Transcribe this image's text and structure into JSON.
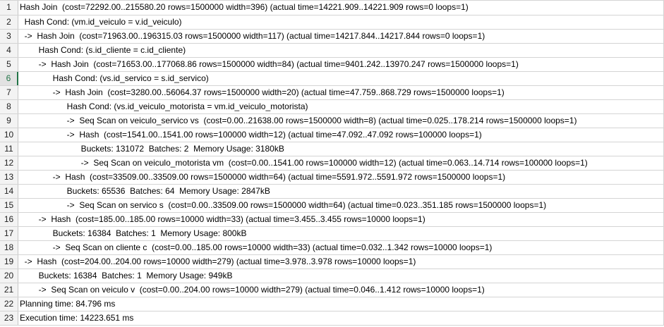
{
  "rows": [
    {
      "n": "1",
      "text": "Hash Join  (cost=72292.00..215580.20 rows=1500000 width=396) (actual time=14221.909..14221.909 rows=0 loops=1)"
    },
    {
      "n": "2",
      "text": "  Hash Cond: (vm.id_veiculo = v.id_veiculo)"
    },
    {
      "n": "3",
      "text": "  ->  Hash Join  (cost=71963.00..196315.03 rows=1500000 width=117) (actual time=14217.844..14217.844 rows=0 loops=1)"
    },
    {
      "n": "4",
      "text": "        Hash Cond: (s.id_cliente = c.id_cliente)"
    },
    {
      "n": "5",
      "text": "        ->  Hash Join  (cost=71653.00..177068.86 rows=1500000 width=84) (actual time=9401.242..13970.247 rows=1500000 loops=1)"
    },
    {
      "n": "6",
      "text": "              Hash Cond: (vs.id_servico = s.id_servico)"
    },
    {
      "n": "7",
      "text": "              ->  Hash Join  (cost=3280.00..56064.37 rows=1500000 width=20) (actual time=47.759..868.729 rows=1500000 loops=1)"
    },
    {
      "n": "8",
      "text": "                    Hash Cond: (vs.id_veiculo_motorista = vm.id_veiculo_motorista)"
    },
    {
      "n": "9",
      "text": "                    ->  Seq Scan on veiculo_servico vs  (cost=0.00..21638.00 rows=1500000 width=8) (actual time=0.025..178.214 rows=1500000 loops=1)"
    },
    {
      "n": "10",
      "text": "                    ->  Hash  (cost=1541.00..1541.00 rows=100000 width=12) (actual time=47.092..47.092 rows=100000 loops=1)"
    },
    {
      "n": "11",
      "text": "                          Buckets: 131072  Batches: 2  Memory Usage: 3180kB"
    },
    {
      "n": "12",
      "text": "                          ->  Seq Scan on veiculo_motorista vm  (cost=0.00..1541.00 rows=100000 width=12) (actual time=0.063..14.714 rows=100000 loops=1)"
    },
    {
      "n": "13",
      "text": "              ->  Hash  (cost=33509.00..33509.00 rows=1500000 width=64) (actual time=5591.972..5591.972 rows=1500000 loops=1)"
    },
    {
      "n": "14",
      "text": "                    Buckets: 65536  Batches: 64  Memory Usage: 2847kB"
    },
    {
      "n": "15",
      "text": "                    ->  Seq Scan on servico s  (cost=0.00..33509.00 rows=1500000 width=64) (actual time=0.023..351.185 rows=1500000 loops=1)"
    },
    {
      "n": "16",
      "text": "        ->  Hash  (cost=185.00..185.00 rows=10000 width=33) (actual time=3.455..3.455 rows=10000 loops=1)"
    },
    {
      "n": "17",
      "text": "              Buckets: 16384  Batches: 1  Memory Usage: 800kB"
    },
    {
      "n": "18",
      "text": "              ->  Seq Scan on cliente c  (cost=0.00..185.00 rows=10000 width=33) (actual time=0.032..1.342 rows=10000 loops=1)"
    },
    {
      "n": "19",
      "text": "  ->  Hash  (cost=204.00..204.00 rows=10000 width=279) (actual time=3.978..3.978 rows=10000 loops=1)"
    },
    {
      "n": "20",
      "text": "        Buckets: 16384  Batches: 1  Memory Usage: 949kB"
    },
    {
      "n": "21",
      "text": "        ->  Seq Scan on veiculo v  (cost=0.00..204.00 rows=10000 width=279) (actual time=0.046..1.412 rows=10000 loops=1)"
    },
    {
      "n": "22",
      "text": "Planning time: 84.796 ms"
    },
    {
      "n": "23",
      "text": "Execution time: 14223.651 ms"
    }
  ],
  "selected_row": "6"
}
